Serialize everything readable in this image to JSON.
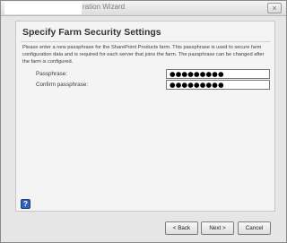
{
  "window": {
    "title_visible_fragment": "ration Wizard",
    "close_glyph": "×"
  },
  "page": {
    "title": "Specify Farm Security Settings",
    "description": "Please enter a new passphrase for the SharePoint Products farm. This passphrase is used to secure farm configuration data and is required for each server that joins the farm. The passphrase can be changed after the farm is configured."
  },
  "form": {
    "passphrase_label": "Passphrase:",
    "passphrase_value": "●●●●●●●●●",
    "confirm_label": "Confirm passphrase:",
    "confirm_value": "●●●●●●●●●"
  },
  "footer": {
    "help_glyph": "?",
    "back_label": "< Back",
    "next_label": "Next >",
    "cancel_label": "Cancel"
  },
  "colors": {
    "help_icon": "#2f62b8",
    "content_bg": "#f4f4f4",
    "window_bg": "#e6e6e6"
  },
  "icons": {
    "close": "close-icon",
    "help": "help-icon"
  }
}
